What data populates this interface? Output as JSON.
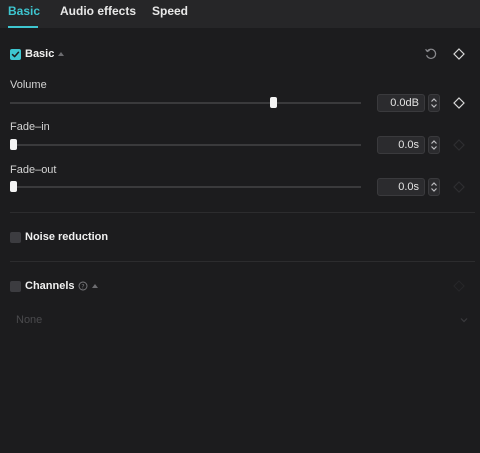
{
  "tabs": [
    {
      "label": "Basic",
      "active": true
    },
    {
      "label": "Audio effects",
      "active": false
    },
    {
      "label": "Speed",
      "active": false
    }
  ],
  "basic": {
    "title": "Basic",
    "checked": true,
    "reset_icon": "reset-icon",
    "keyframe_icon": "keyframe-diamond-icon"
  },
  "volume": {
    "label": "Volume",
    "value": "0.0dB",
    "level": 0.75
  },
  "fade_in": {
    "label": "Fade–in",
    "value": "0.0s",
    "level": 0
  },
  "fade_out": {
    "label": "Fade–out",
    "value": "0.0s",
    "level": 0
  },
  "noise_reduction": {
    "label": "Noise reduction",
    "checked": false
  },
  "channels": {
    "label": "Channels",
    "checked": false,
    "info_icon": "info-icon",
    "select_value": "None"
  },
  "colors": {
    "accent": "#3ec6d0",
    "background": "#1c1c1e",
    "tab_bar": "#262628",
    "thumb": "#f3f3f3"
  }
}
